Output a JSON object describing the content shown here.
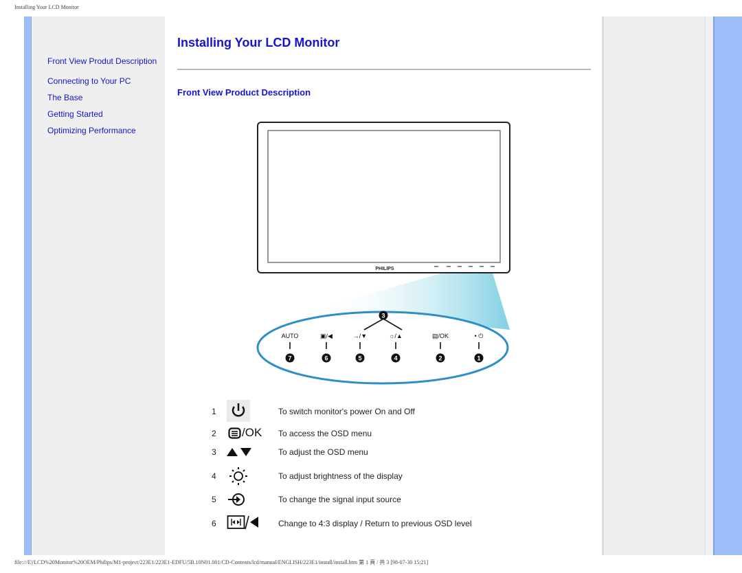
{
  "page_header": "Installing Your LCD Monitor",
  "sidebar": {
    "items": [
      {
        "label": "Front View Produt Description"
      },
      {
        "label": "Connecting to Your PC"
      },
      {
        "label": "The Base"
      },
      {
        "label": "Getting Started"
      },
      {
        "label": "Optimizing Performance"
      }
    ]
  },
  "main": {
    "title": "Installing Your LCD Monitor",
    "subtitle": "Front View Product Description",
    "figure": {
      "brand": "PHILIPS",
      "buttons": [
        {
          "label": "AUTO",
          "number": "7"
        },
        {
          "label": "▣/◀",
          "number": "6"
        },
        {
          "label": "→/▼",
          "number": "5"
        },
        {
          "label": "☼/▲",
          "number": "4"
        },
        {
          "label": "▤/OK",
          "number": "2"
        },
        {
          "label": "• ⏻",
          "number": "1"
        }
      ],
      "group_number": "3"
    },
    "controls": [
      {
        "num": "1",
        "icon": "power-icon",
        "description": "To switch monitor's power On and Off"
      },
      {
        "num": "2",
        "icon": "menu-ok-icon",
        "ok_label": "/OK",
        "description": "To access the OSD menu"
      },
      {
        "num": "3",
        "icon": "up-down-icon",
        "description": "To adjust the OSD menu"
      },
      {
        "num": "4",
        "icon": "brightness-icon",
        "description": "To adjust brightness of the display"
      },
      {
        "num": "5",
        "icon": "input-source-icon",
        "description": "To change the signal input source"
      },
      {
        "num": "6",
        "icon": "aspect-back-icon",
        "description": "Change to 4:3 display / Return to previous OSD level"
      }
    ]
  },
  "page_footer": "file:///E|/LCD%20Monitor%20OEM/Philips/M1-project/223E1/223E1-EDFU/5B.10N01.001/CD-Contents/lcd/manual/ENGLISH/223E1/install/install.htm 第 1 頁 / 共 3 [98-07-30 15:21]"
}
